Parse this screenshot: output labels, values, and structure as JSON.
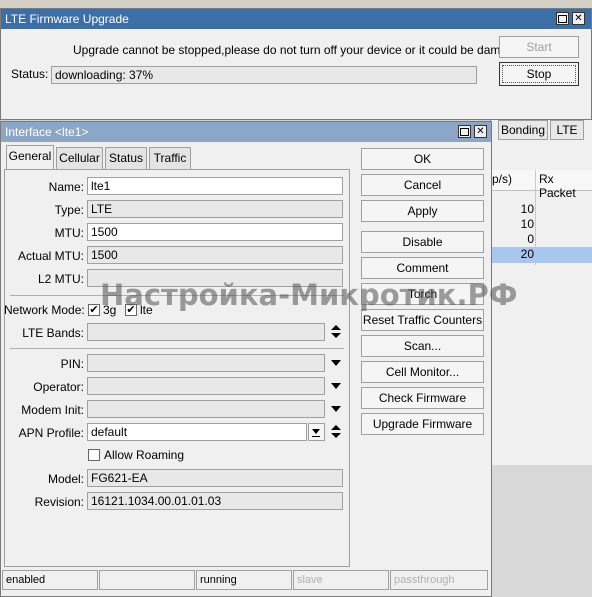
{
  "firmware_window": {
    "title": "LTE Firmware Upgrade",
    "warning": "Upgrade cannot be stopped,please do not turn off your device or it could be damaged",
    "status_label": "Status:",
    "status_value": "downloading: 37%",
    "start_label": "Start",
    "stop_label": "Stop"
  },
  "background_window": {
    "tabs": [
      "Bonding",
      "LTE"
    ],
    "col_header_1": "p/s)",
    "col_header_2": "Rx Packet",
    "rows": [
      "10",
      "10",
      "0",
      "20"
    ]
  },
  "interface_window": {
    "title": "Interface <lte1>",
    "tabs": [
      "General",
      "Cellular",
      "Status",
      "Traffic"
    ],
    "fields": {
      "name_label": "Name:",
      "name_value": "lte1",
      "type_label": "Type:",
      "type_value": "LTE",
      "mtu_label": "MTU:",
      "mtu_value": "1500",
      "actual_mtu_label": "Actual MTU:",
      "actual_mtu_value": "1500",
      "l2mtu_label": "L2 MTU:",
      "l2mtu_value": "",
      "network_mode_label": "Network Mode:",
      "mode_3g": "3g",
      "mode_lte": "lte",
      "lte_bands_label": "LTE Bands:",
      "pin_label": "PIN:",
      "operator_label": "Operator:",
      "modem_init_label": "Modem Init:",
      "apn_profile_label": "APN Profile:",
      "apn_profile_value": "default",
      "allow_roaming_label": "Allow Roaming",
      "model_label": "Model:",
      "model_value": "FG621-EA",
      "revision_label": "Revision:",
      "revision_value": "16121.1034.00.01.01.03"
    },
    "buttons": {
      "ok": "OK",
      "cancel": "Cancel",
      "apply": "Apply",
      "disable": "Disable",
      "comment": "Comment",
      "torch": "Torch",
      "reset_counters": "Reset Traffic Counters",
      "scan": "Scan...",
      "cell_monitor": "Cell Monitor...",
      "check_firmware": "Check Firmware",
      "upgrade_firmware": "Upgrade Firmware"
    },
    "statusbar": {
      "state": "enabled",
      "running": "running",
      "slave": "slave",
      "passthrough": "passthrough"
    }
  },
  "watermark": "Настройка-Микротик.РФ"
}
